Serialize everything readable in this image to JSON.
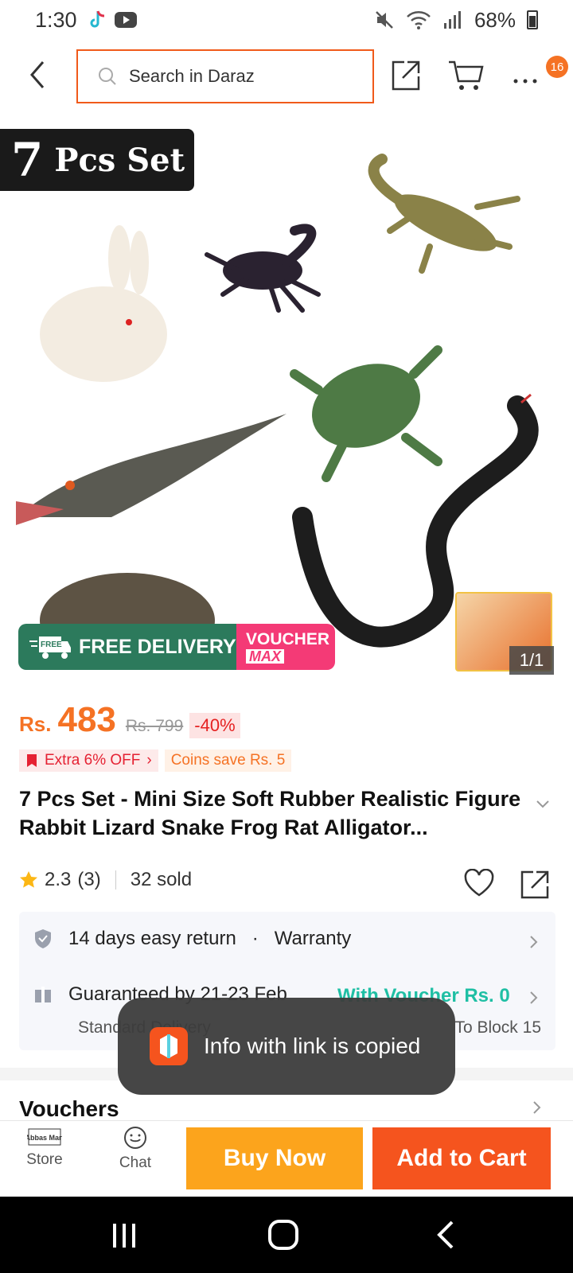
{
  "status_bar": {
    "time": "1:30",
    "battery": "68%"
  },
  "header": {
    "search_placeholder": "Search in Daraz",
    "cart_badge": "16"
  },
  "image": {
    "banner_number": "7",
    "banner_text": "Pcs Set",
    "counter": "1/1",
    "promo_left": "FREE DELIVERY",
    "promo_left_tag": "FREE",
    "promo_right_1": "VOUCHER",
    "promo_right_2": "MAX"
  },
  "price": {
    "currency": "Rs.",
    "value": "483",
    "old": "Rs. 799",
    "discount": "-40%"
  },
  "tags": {
    "extra": "Extra 6% OFF",
    "coins": "Coins save Rs. 5"
  },
  "product": {
    "title": "7 Pcs Set - Mini Size Soft Rubber Realistic Figure Rabbit Lizard Snake Frog Rat Alligator..."
  },
  "rating": {
    "score": "2.3",
    "count": "(3)",
    "sold": "32 sold"
  },
  "service": {
    "return": "14 days easy return",
    "warranty": "Warranty",
    "delivery": "Guaranteed by 21-23 Feb",
    "voucher": "With Voucher Rs. 0",
    "standard": "Standard Delivery",
    "to_block": "To Block 15"
  },
  "vouchers_title": "Vouchers",
  "toast": {
    "text": "Info with link is copied"
  },
  "bottom": {
    "store": "Store",
    "chat": "Chat",
    "buy_now": "Buy Now",
    "add_to_cart": "Add to Cart",
    "store_logo": "Abbas Mart"
  },
  "colors": {
    "accent": "#f57224",
    "buy": "#fca41c",
    "cart": "#f5541e",
    "voucher_green": "#1fbfa4"
  }
}
